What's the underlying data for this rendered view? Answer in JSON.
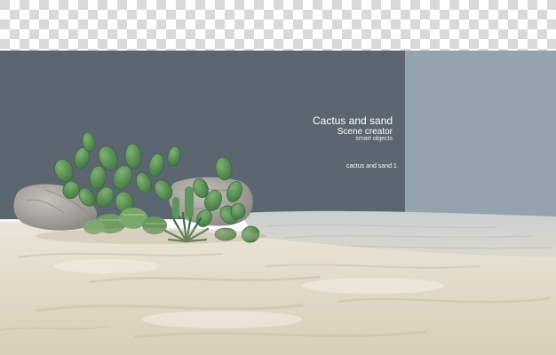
{
  "caption": {
    "title": "Cactus and sand",
    "subtitle": "Scene creator",
    "subtitle_small": "smart objects",
    "variant_label": "cactus and sand 1"
  },
  "colors": {
    "panel_dark": "#5b6670",
    "panel_light": "#95a3ae",
    "sand": "#e3dccb",
    "cactus": "#4f8a4f",
    "rock": "#a7a59e",
    "checker_dark": "#d9d9d9",
    "checker_light": "#ffffff"
  },
  "icons": {
    "background": "transparency-checkerboard",
    "plants": "prickly-pear-cactus-icon",
    "rocks": "boulder-icon"
  }
}
